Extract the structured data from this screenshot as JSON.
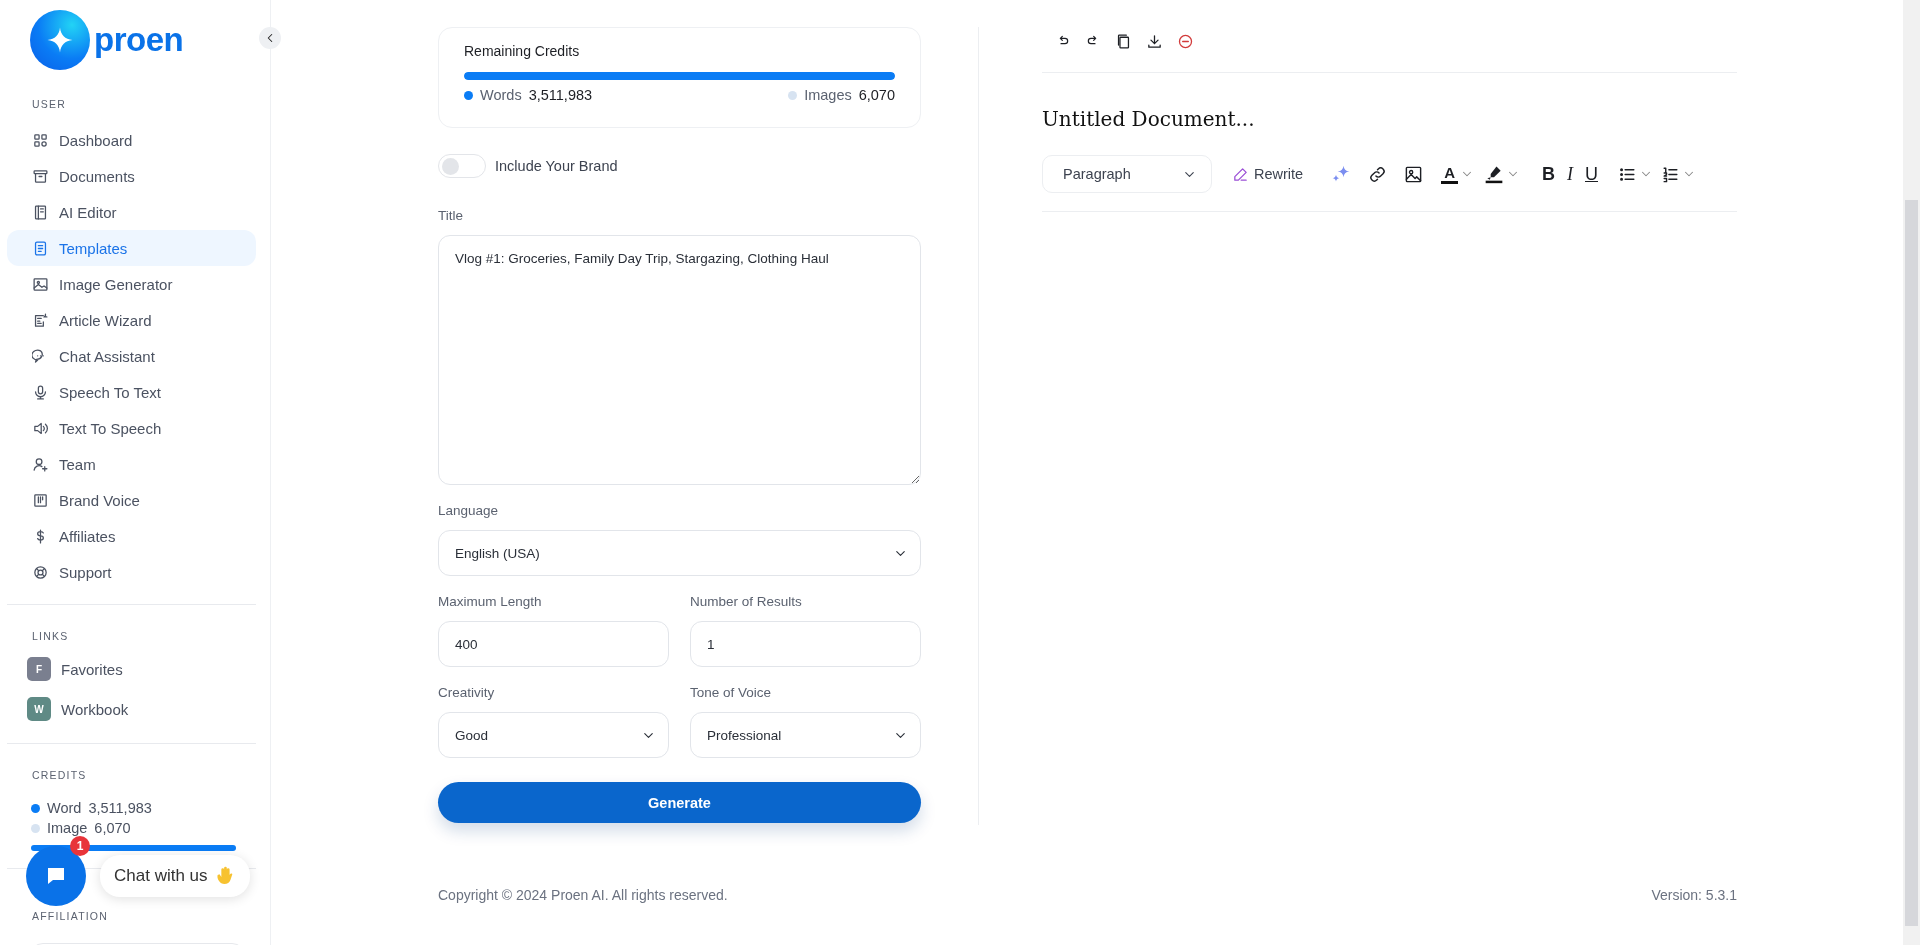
{
  "sidebar": {
    "logo": "proen",
    "user": {
      "heading": "USER",
      "items": [
        {
          "label": "Dashboard",
          "selected": false
        },
        {
          "label": "Documents",
          "selected": false
        },
        {
          "label": "AI Editor",
          "selected": false
        },
        {
          "label": "Templates",
          "selected": true
        },
        {
          "label": "Image Generator",
          "selected": false
        },
        {
          "label": "Article Wizard",
          "selected": false
        },
        {
          "label": "Chat Assistant",
          "selected": false
        },
        {
          "label": "Speech To Text",
          "selected": false
        },
        {
          "label": "Text To Speech",
          "selected": false
        },
        {
          "label": "Team",
          "selected": false
        },
        {
          "label": "Brand Voice",
          "selected": false
        },
        {
          "label": "Affiliates",
          "selected": false
        },
        {
          "label": "Support",
          "selected": false
        }
      ]
    },
    "links": {
      "heading": "LINKS",
      "items": [
        {
          "letter": "F",
          "label": "Favorites",
          "color": "#7a7f8f"
        },
        {
          "letter": "W",
          "label": "Workbook",
          "color": "#5f8a85"
        }
      ]
    },
    "credits": {
      "heading": "CREDITS",
      "level": 1,
      "items": [
        {
          "label": "Word",
          "value": "3,511,983",
          "color": "#0a7cf5"
        },
        {
          "label": "Image",
          "value": "6,070",
          "color": "#d7e3f1"
        }
      ]
    },
    "affiliation": {
      "heading": "AFFILIATION"
    }
  },
  "chat": {
    "label": "Chat with us",
    "badge": "1"
  },
  "credits_card": {
    "title": "Remaining Credits",
    "level": 1,
    "legend": [
      {
        "label": "Words",
        "value": "3,511,983",
        "color": "#0a7cf5"
      },
      {
        "label": "Images",
        "value": "6,070",
        "color": "#d7e3f1"
      }
    ]
  },
  "brand_toggle": {
    "label": "Include Your Brand",
    "on": false
  },
  "fields": [
    {
      "kind": "textarea",
      "label": "Title",
      "value": "Vlog #1: Groceries, Family Day Trip, Stargazing, Clothing Haul"
    },
    {
      "kind": "select",
      "label": "Language",
      "value": "English (USA)"
    },
    {
      "kind": "input",
      "label": "Maximum Length",
      "value": "400"
    },
    {
      "kind": "input",
      "label": "Number of Results",
      "value": "1"
    },
    {
      "kind": "select",
      "label": "Creativity",
      "value": "Good"
    },
    {
      "kind": "select",
      "label": "Tone of Voice",
      "value": "Professional"
    }
  ],
  "generate_button": "Generate",
  "editor": {
    "title": "Untitled Document...",
    "block_style": "Paragraph",
    "rewrite": "Rewrite",
    "format": [
      {
        "kind": "bold",
        "glyph": "B"
      },
      {
        "kind": "italic",
        "glyph": "I"
      },
      {
        "kind": "underline",
        "glyph": "U"
      }
    ],
    "text_color_glyph": "A"
  },
  "footer": {
    "copyright": "Copyright © 2024 Proen AI. All rights reserved.",
    "version": "Version: 5.3.1"
  }
}
